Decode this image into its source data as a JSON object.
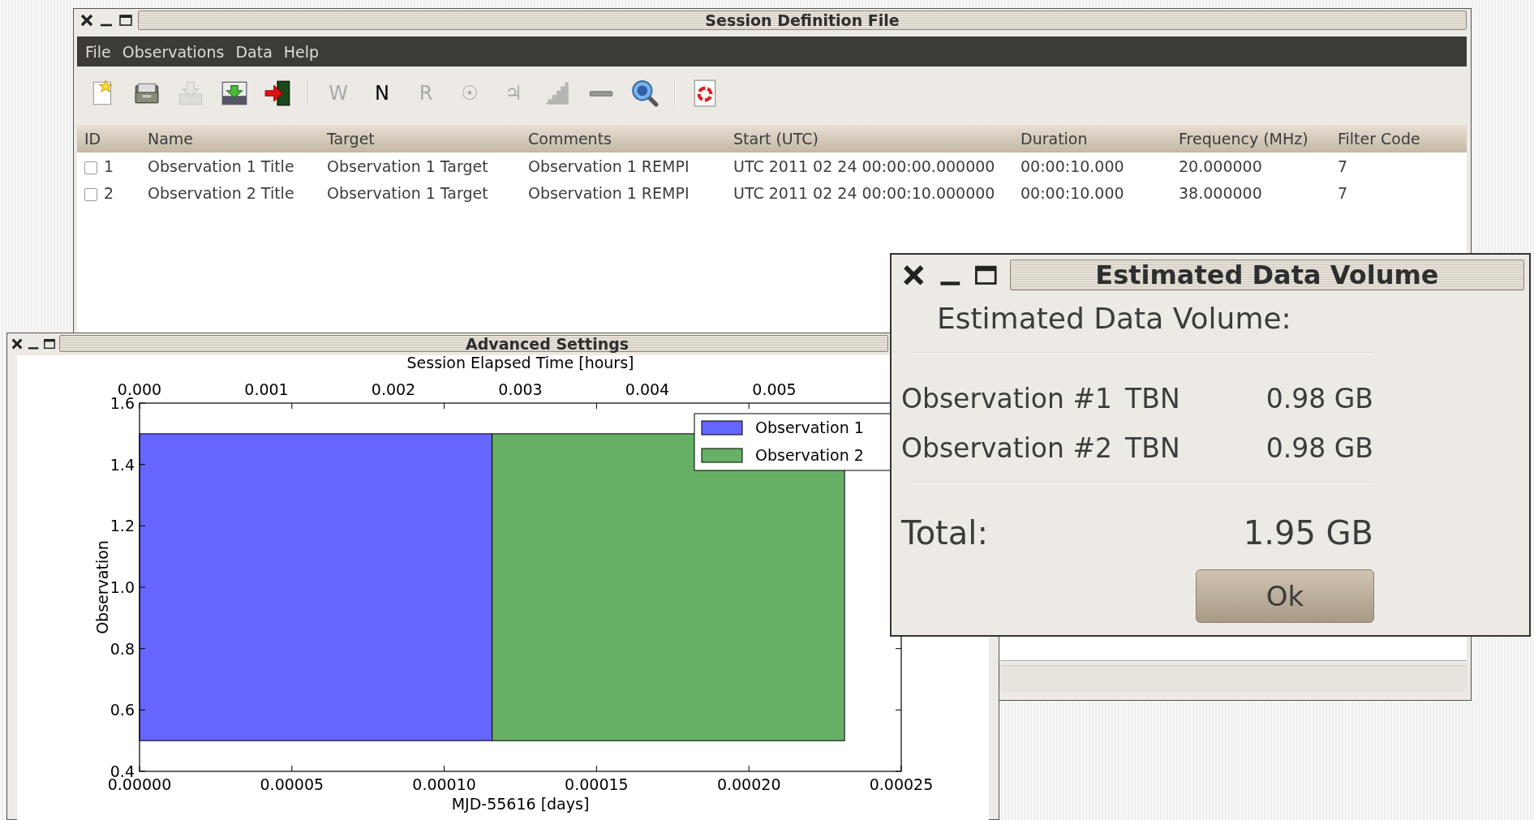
{
  "main_window": {
    "title": "Session Definition File",
    "menu": [
      "File",
      "Observations",
      "Data",
      "Help"
    ],
    "toolbar": [
      {
        "kind": "icon",
        "disabled": false
      },
      {
        "kind": "icon",
        "disabled": false
      },
      {
        "kind": "icon",
        "disabled": true
      },
      {
        "kind": "icon",
        "disabled": false
      },
      {
        "kind": "icon",
        "disabled": false
      },
      {
        "kind": "separator"
      },
      {
        "kind": "text",
        "label": "W",
        "disabled": true
      },
      {
        "kind": "text",
        "label": "N",
        "disabled": false
      },
      {
        "kind": "text",
        "label": "R",
        "disabled": true
      },
      {
        "kind": "text",
        "label": "☉",
        "disabled": true
      },
      {
        "kind": "text",
        "label": "♃",
        "disabled": true
      },
      {
        "kind": "icon",
        "disabled": true
      },
      {
        "kind": "icon",
        "disabled": false
      },
      {
        "kind": "icon",
        "disabled": false
      },
      {
        "kind": "separator"
      },
      {
        "kind": "icon",
        "disabled": false
      }
    ],
    "table": {
      "columns": [
        "ID",
        "Name",
        "Target",
        "Comments",
        "Start (UTC)",
        "Duration",
        "Frequency (MHz)",
        "Filter Code"
      ],
      "rows": [
        {
          "checked": false,
          "cells": [
            "1",
            "Observation 1 Title",
            "Observation 1 Target",
            "Observation 1 REMPI",
            "UTC 2011 02 24 00:00:00.000000",
            "00:00:10.000",
            "20.000000",
            "7"
          ]
        },
        {
          "checked": false,
          "cells": [
            "2",
            "Observation 2 Title",
            "Observation 1 Target",
            "Observation 1 REMPI",
            "UTC 2011 02 24 00:00:10.000000",
            "00:00:10.000",
            "38.000000",
            "7"
          ]
        }
      ]
    }
  },
  "advanced_window": {
    "title": "Advanced Settings",
    "top_axis": {
      "label": "Session Elapsed Time [hours]",
      "ticks": [
        "0.000",
        "0.001",
        "0.002",
        "0.003",
        "0.004",
        "0.005"
      ]
    },
    "chart_data": {
      "type": "bar",
      "orientation": "horizontal",
      "stacked": true,
      "xlabel": "MJD-55616 [days]",
      "ylabel": "Observation",
      "x": [
        1.0
      ],
      "legend": true,
      "series": [
        {
          "name": "Observation 1",
          "color": "#6565ff",
          "values": [
            0.0001157
          ]
        },
        {
          "name": "Observation 2",
          "color": "#65b065",
          "values": [
            0.0001157
          ]
        }
      ],
      "xlim": [
        0,
        0.00025
      ],
      "ylim": [
        0.4,
        1.6
      ],
      "xticks": [
        {
          "value": 0,
          "label": "0.00000"
        },
        {
          "value": 5e-05,
          "label": "0.00005"
        },
        {
          "value": 0.0001,
          "label": "0.00010"
        },
        {
          "value": 0.00015,
          "label": "0.00015"
        },
        {
          "value": 0.0002,
          "label": "0.00020"
        },
        {
          "value": 0.00025,
          "label": "0.00025"
        }
      ],
      "yticks": [
        {
          "value": 0.4,
          "label": "0.4"
        },
        {
          "value": 0.6,
          "label": "0.6"
        },
        {
          "value": 0.8,
          "label": "0.8"
        },
        {
          "value": 1.0,
          "label": "1.0"
        },
        {
          "value": 1.2,
          "label": "1.2"
        },
        {
          "value": 1.4,
          "label": "1.4"
        },
        {
          "value": 1.6,
          "label": "1.6"
        }
      ]
    }
  },
  "volume_dialog": {
    "title": "Estimated Data Volume",
    "heading": "Estimated Data Volume:",
    "items": [
      {
        "name": "Observation #1",
        "mode": "TBN",
        "size": "0.98 GB"
      },
      {
        "name": "Observation #2",
        "mode": "TBN",
        "size": "0.98 GB"
      }
    ],
    "total_label": "Total:",
    "total": "1.95 GB",
    "button": "Ok"
  }
}
